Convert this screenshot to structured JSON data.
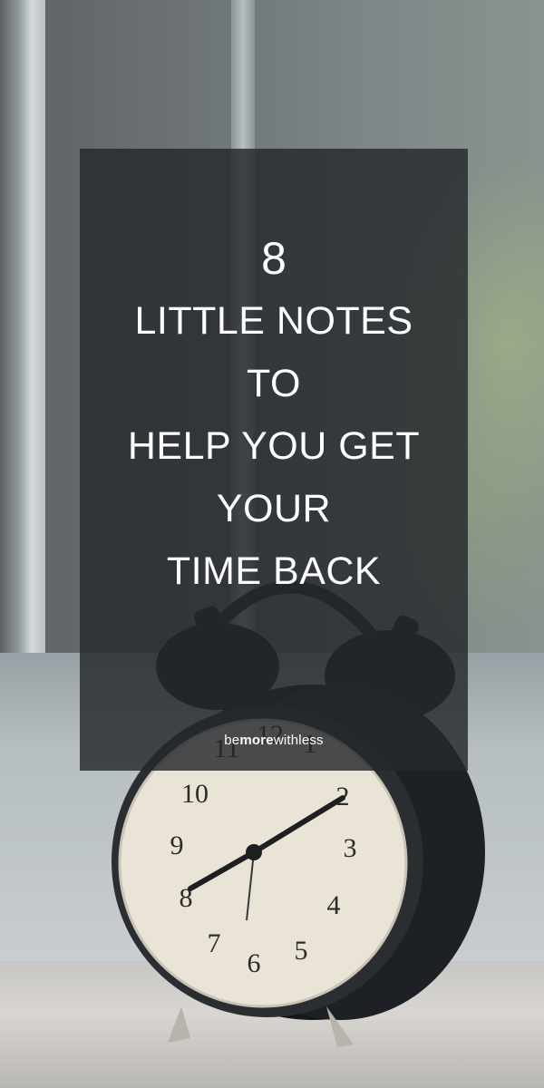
{
  "headline": {
    "number": "8",
    "lines": [
      "LITTLE NOTES",
      "TO",
      "HELP YOU GET",
      "YOUR",
      "TIME BACK"
    ]
  },
  "brand": {
    "part1": "be",
    "part2": "more",
    "part3": "withless"
  },
  "clock": {
    "numerals": [
      "12",
      "1",
      "2",
      "3",
      "4",
      "5",
      "6",
      "7",
      "8",
      "9",
      "10",
      "11"
    ]
  }
}
